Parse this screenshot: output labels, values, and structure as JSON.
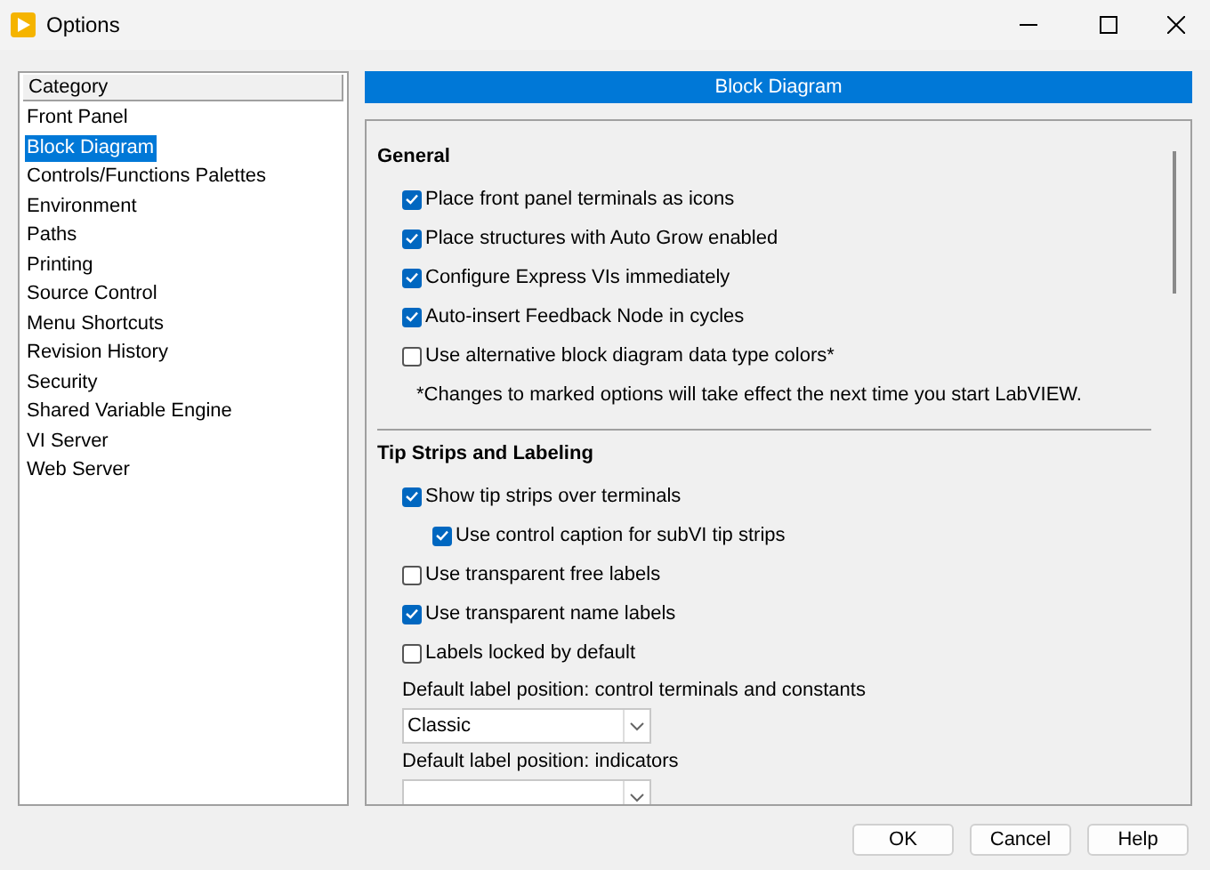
{
  "window": {
    "title": "Options"
  },
  "sidebar": {
    "header": "Category",
    "items": [
      {
        "label": "Front Panel",
        "selected": false
      },
      {
        "label": "Block Diagram",
        "selected": true
      },
      {
        "label": "Controls/Functions Palettes",
        "selected": false
      },
      {
        "label": "Environment",
        "selected": false
      },
      {
        "label": "Paths",
        "selected": false
      },
      {
        "label": "Printing",
        "selected": false
      },
      {
        "label": "Source Control",
        "selected": false
      },
      {
        "label": "Menu Shortcuts",
        "selected": false
      },
      {
        "label": "Revision History",
        "selected": false
      },
      {
        "label": "Security",
        "selected": false
      },
      {
        "label": "Shared Variable Engine",
        "selected": false
      },
      {
        "label": "VI Server",
        "selected": false
      },
      {
        "label": "Web Server",
        "selected": false
      }
    ]
  },
  "panel": {
    "title": "Block Diagram",
    "sections": [
      {
        "title": "General",
        "items": [
          {
            "kind": "checkbox",
            "label": "Place front panel terminals as icons",
            "checked": true
          },
          {
            "kind": "checkbox",
            "label": "Place structures with Auto Grow enabled",
            "checked": true
          },
          {
            "kind": "checkbox",
            "label": "Configure Express VIs immediately",
            "checked": true
          },
          {
            "kind": "checkbox",
            "label": "Auto-insert Feedback Node in cycles",
            "checked": true
          },
          {
            "kind": "checkbox",
            "label": "Use alternative block diagram data type colors*",
            "checked": false
          },
          {
            "kind": "note",
            "label": "*Changes to marked options will take effect the next time you start LabVIEW."
          }
        ]
      },
      {
        "title": "Tip Strips and Labeling",
        "items": [
          {
            "kind": "checkbox",
            "label": "Show tip strips over terminals",
            "checked": true,
            "children": [
              {
                "kind": "checkbox",
                "label": "Use control caption for subVI tip strips",
                "checked": true
              }
            ]
          },
          {
            "kind": "checkbox",
            "label": "Use transparent free labels",
            "checked": false
          },
          {
            "kind": "checkbox",
            "label": "Use transparent name labels",
            "checked": true
          },
          {
            "kind": "checkbox",
            "label": "Labels locked by default",
            "checked": false
          },
          {
            "kind": "dropdown",
            "label": "Default label position: control terminals and constants",
            "value": "Classic"
          },
          {
            "kind": "dropdown",
            "label": "Default label position: indicators"
          }
        ]
      }
    ]
  },
  "buttons": [
    "OK",
    "Cancel",
    "Help"
  ]
}
